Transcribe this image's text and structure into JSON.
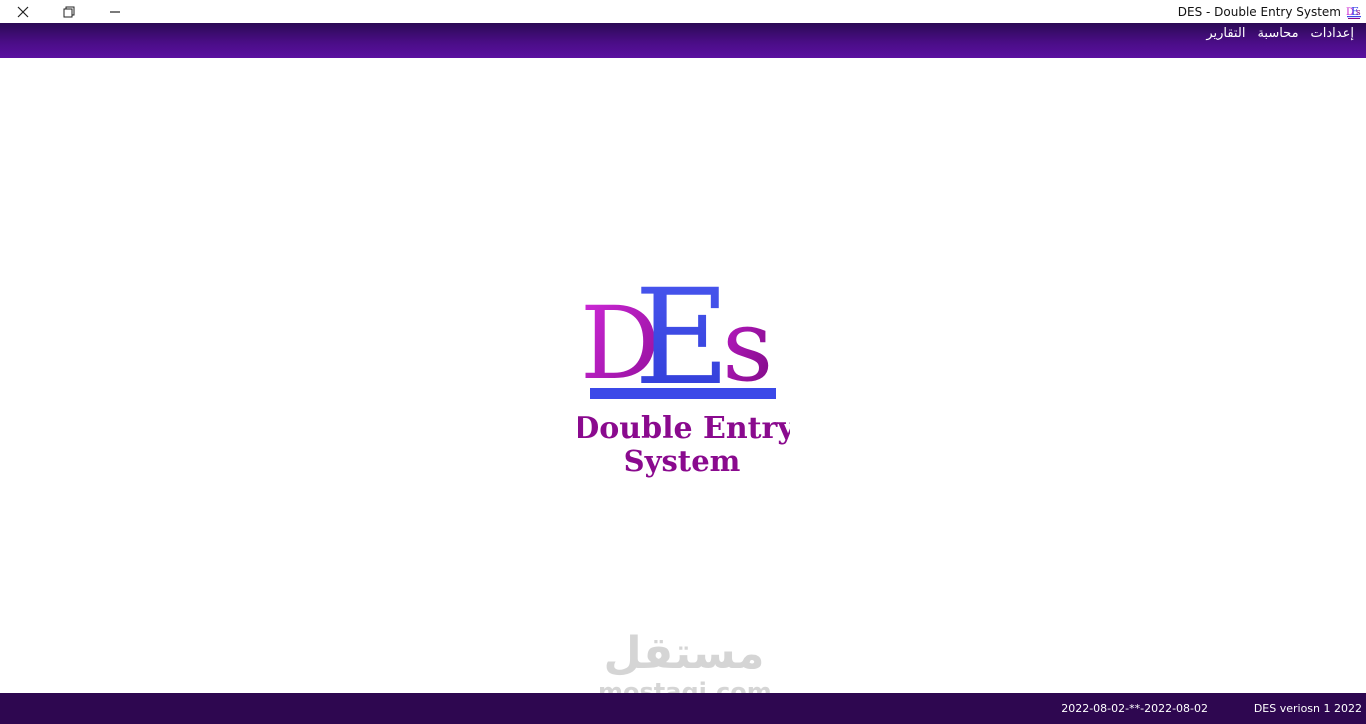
{
  "window": {
    "title": "DES - Double Entry System",
    "controls": {
      "close_icon": "close-icon",
      "restore_icon": "restore-icon",
      "minimize_icon": "minimize-icon"
    }
  },
  "menu": {
    "items": [
      {
        "label": "إعدادات"
      },
      {
        "label": "محاسبة"
      },
      {
        "label": "التقارير"
      }
    ]
  },
  "logo": {
    "letters": [
      "D",
      "E",
      "s"
    ],
    "line1": "Double Entry",
    "line2": "System",
    "colors": {
      "magenta": "#c81fd0",
      "purple": "#8a0a8e",
      "blue": "#3b49e8"
    }
  },
  "watermark": {
    "arabic": "مستقل",
    "latin": "mostaqi.com"
  },
  "status": {
    "dates": "2022-08-02-**-2022-08-02",
    "version": "DES veriosn 1 2022"
  },
  "colors": {
    "menubar": "#4a0d86",
    "statusbar": "#2e0750"
  }
}
